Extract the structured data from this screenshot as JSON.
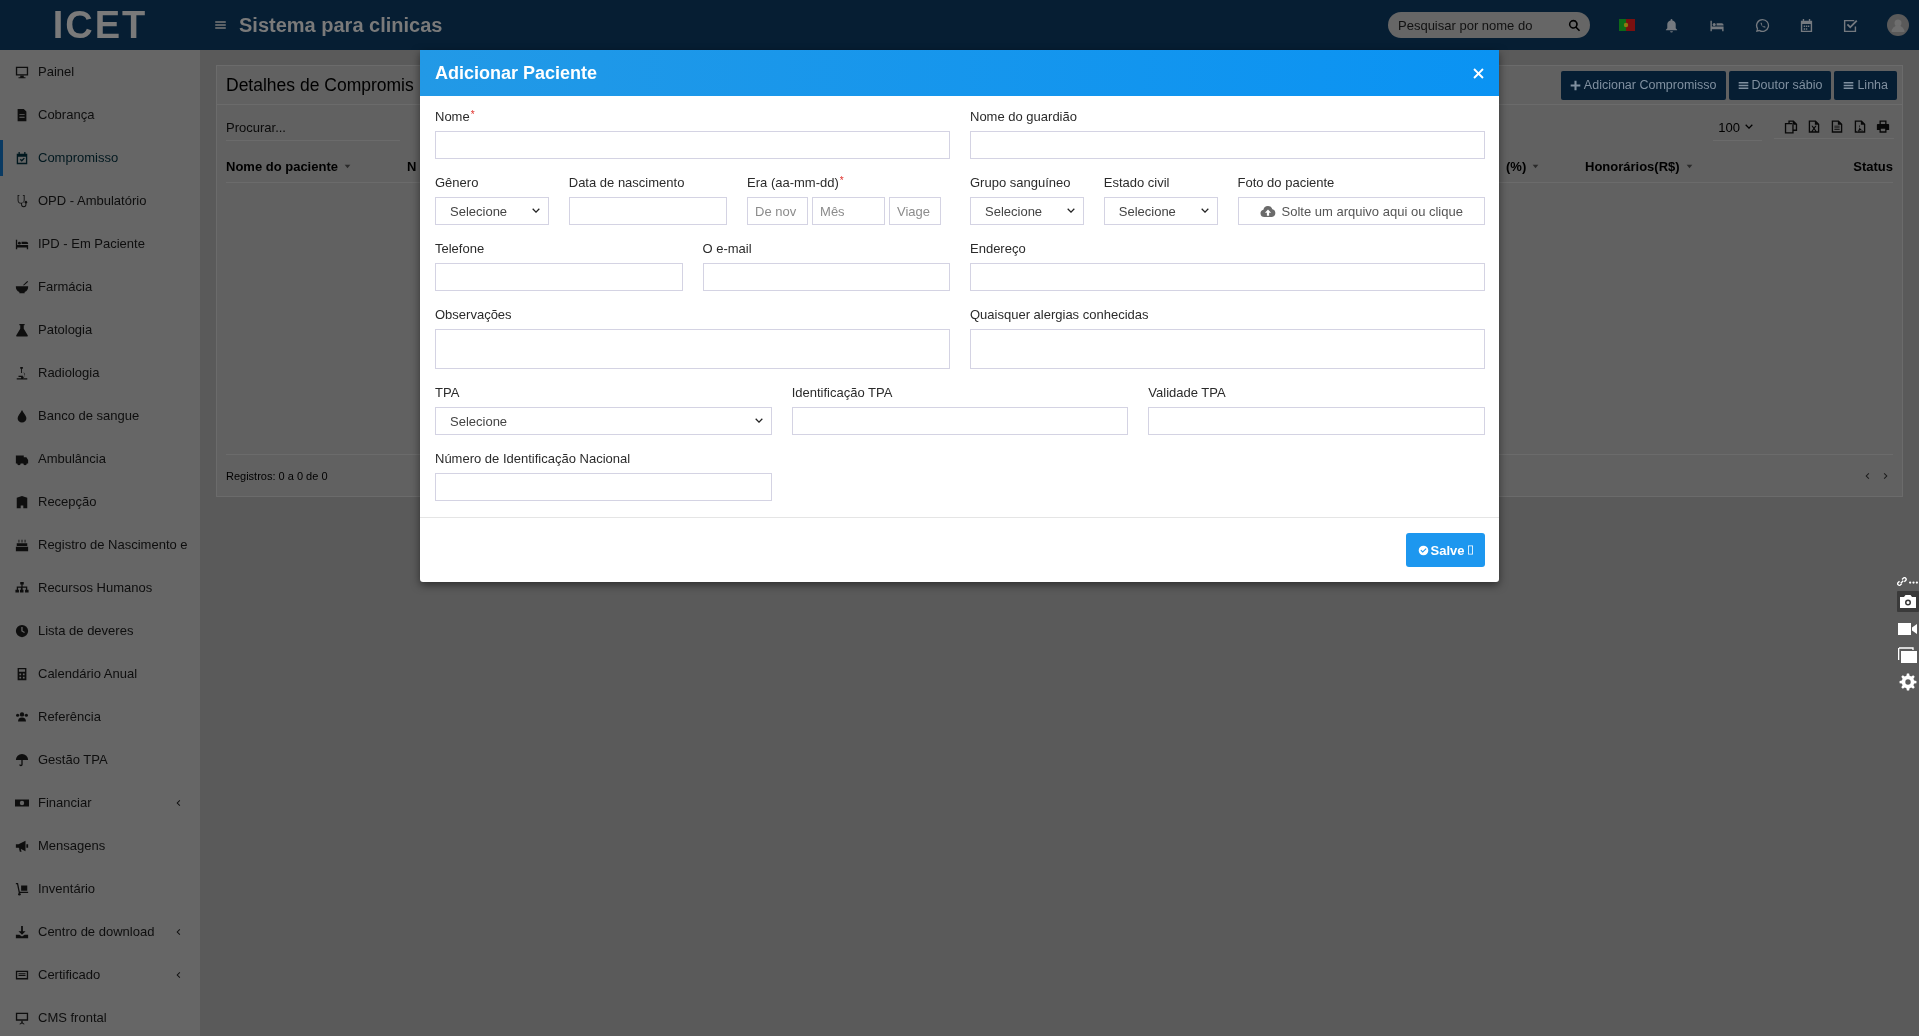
{
  "topbar": {
    "logo": "ICET",
    "title": "Sistema para clinicas",
    "search": {
      "placeholder": "Pesquisar por nome do"
    }
  },
  "sidebar": {
    "items": [
      {
        "label": "Painel",
        "selected": false,
        "has_submenu": false
      },
      {
        "label": "Cobrança",
        "selected": false,
        "has_submenu": false
      },
      {
        "label": "Compromisso",
        "selected": true,
        "has_submenu": false
      },
      {
        "label": "OPD - Ambulatório",
        "selected": false,
        "has_submenu": false
      },
      {
        "label": "IPD - Em Paciente",
        "selected": false,
        "has_submenu": false
      },
      {
        "label": "Farmácia",
        "selected": false,
        "has_submenu": false
      },
      {
        "label": "Patologia",
        "selected": false,
        "has_submenu": false
      },
      {
        "label": "Radiologia",
        "selected": false,
        "has_submenu": false
      },
      {
        "label": "Banco de sangue",
        "selected": false,
        "has_submenu": false
      },
      {
        "label": "Ambulância",
        "selected": false,
        "has_submenu": false
      },
      {
        "label": "Recepção",
        "selected": false,
        "has_submenu": false
      },
      {
        "label": "Registro de Nascimento e",
        "selected": false,
        "has_submenu": false
      },
      {
        "label": "Recursos Humanos",
        "selected": false,
        "has_submenu": false
      },
      {
        "label": "Lista de deveres",
        "selected": false,
        "has_submenu": false
      },
      {
        "label": "Calendário Anual",
        "selected": false,
        "has_submenu": false
      },
      {
        "label": "Referência",
        "selected": false,
        "has_submenu": false
      },
      {
        "label": "Gestão TPA",
        "selected": false,
        "has_submenu": false
      },
      {
        "label": "Financiar",
        "selected": false,
        "has_submenu": true
      },
      {
        "label": "Mensagens",
        "selected": false,
        "has_submenu": false
      },
      {
        "label": "Inventário",
        "selected": false,
        "has_submenu": false
      },
      {
        "label": "Centro de download",
        "selected": false,
        "has_submenu": true
      },
      {
        "label": "Certificado",
        "selected": false,
        "has_submenu": true
      },
      {
        "label": "CMS frontal",
        "selected": false,
        "has_submenu": false
      }
    ]
  },
  "page": {
    "title": "Detalhes de Compromis",
    "buttons": [
      {
        "label": "Adicionar Compromisso",
        "kind": "add"
      },
      {
        "label": "Doutor sábio",
        "kind": "list"
      },
      {
        "label": "Linha",
        "kind": "list"
      }
    ],
    "search": {
      "placeholder": "Procurar..."
    },
    "page_size": "100",
    "table": {
      "columns": [
        {
          "label": "Nome do paciente",
          "sortable": true
        },
        {
          "label": "N"
        },
        {
          "label": "(%)",
          "sortable": true
        },
        {
          "label": "Honorários(R$)",
          "sortable": true
        },
        {
          "label": "Status",
          "sortable": false
        }
      ]
    },
    "footer": "Registros: 0 a 0 de 0"
  },
  "modal": {
    "title": "Adicionar Paciente",
    "required_mark": "*",
    "fields": [
      {
        "label": "Nome",
        "required": true,
        "kind": "text"
      },
      {
        "label": "Nome do guardião",
        "required": false,
        "kind": "text"
      },
      {
        "label": "Gênero",
        "required": false,
        "kind": "select",
        "value": "Selecione"
      },
      {
        "label": "Data de nascimento",
        "required": false,
        "kind": "text"
      },
      {
        "label": "Era (aa-mm-dd)",
        "required": true,
        "kind": "split",
        "placeholders": [
          "De nov",
          "Mês",
          "Viage"
        ]
      },
      {
        "label": "Grupo sanguíneo",
        "required": false,
        "kind": "select",
        "value": "Selecione"
      },
      {
        "label": "Estado civil",
        "required": false,
        "kind": "select",
        "value": "Selecione"
      },
      {
        "label": "Foto do paciente",
        "required": false,
        "kind": "file",
        "prompt": "Solte um arquivo aqui ou clique"
      },
      {
        "label": "Telefone",
        "required": false,
        "kind": "text"
      },
      {
        "label": "O e-mail",
        "required": false,
        "kind": "text"
      },
      {
        "label": "Endereço",
        "required": false,
        "kind": "text"
      },
      {
        "label": "Observações",
        "required": false,
        "kind": "textarea"
      },
      {
        "label": "Quaisquer alergias conhecidas",
        "required": false,
        "kind": "textarea"
      },
      {
        "label": "TPA",
        "required": false,
        "kind": "select",
        "value": "Selecione"
      },
      {
        "label": "Identificação TPA",
        "required": false,
        "kind": "text"
      },
      {
        "label": "Validade TPA",
        "required": false,
        "kind": "text"
      },
      {
        "label": "Número de Identificação Nacional",
        "required": false,
        "kind": "text"
      }
    ],
    "save_button": {
      "label": "Salve"
    }
  }
}
